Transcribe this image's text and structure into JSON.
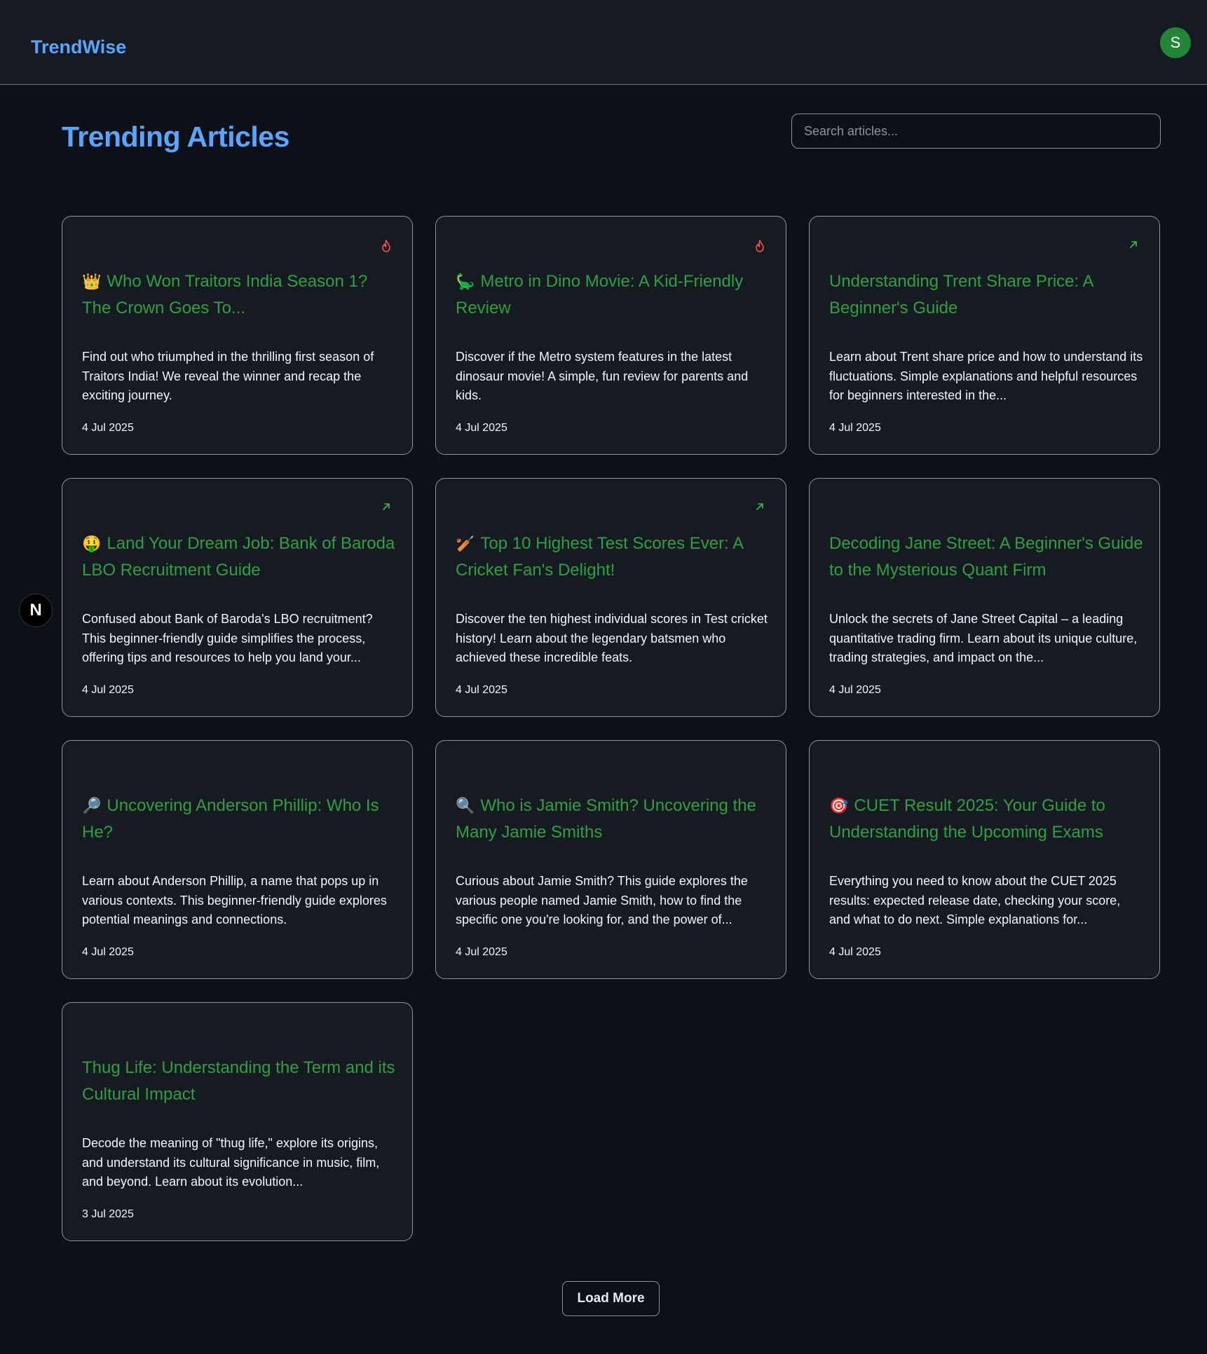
{
  "brand": "TrendWise",
  "user": {
    "initial": "S"
  },
  "page": {
    "title": "Trending Articles"
  },
  "search": {
    "placeholder": "Search articles..."
  },
  "floating_badge": "N",
  "articles": [
    {
      "emoji": "👑",
      "badge": "fire-icon",
      "title": "Who Won Traitors India Season 1? The Crown Goes To...",
      "description": "Find out who triumphed in the thrilling first season of Traitors India! We reveal the winner and recap the exciting journey.",
      "date": "4 Jul 2025"
    },
    {
      "emoji": "🦕",
      "badge": "fire-icon",
      "title": "Metro in Dino Movie: A Kid-Friendly Review",
      "description": "Discover if the Metro system features in the latest dinosaur movie! A simple, fun review for parents and kids.",
      "date": "4 Jul 2025"
    },
    {
      "emoji": "",
      "badge": "trend-arrow-icon",
      "title": "Understanding Trent Share Price: A Beginner's Guide",
      "description": "Learn about Trent share price and how to understand its fluctuations. Simple explanations and helpful resources for beginners interested in the...",
      "date": "4 Jul 2025"
    },
    {
      "emoji": "🤑",
      "badge": "trend-arrow-icon",
      "title": "Land Your Dream Job: Bank of Baroda LBO Recruitment Guide",
      "description": "Confused about Bank of Baroda's LBO recruitment? This beginner-friendly guide simplifies the process, offering tips and resources to help you land your...",
      "date": "4 Jul 2025"
    },
    {
      "emoji": "🏏",
      "badge": "trend-arrow-icon",
      "title": "Top 10 Highest Test Scores Ever: A Cricket Fan's Delight!",
      "description": "Discover the ten highest individual scores in Test cricket history! Learn about the legendary batsmen who achieved these incredible feats.",
      "date": "4 Jul 2025"
    },
    {
      "emoji": "",
      "badge": "",
      "title": "Decoding Jane Street: A Beginner's Guide to the Mysterious Quant Firm",
      "description": "Unlock the secrets of Jane Street Capital – a leading quantitative trading firm. Learn about its unique culture, trading strategies, and impact on the...",
      "date": "4 Jul 2025"
    },
    {
      "emoji": "🔎",
      "badge": "",
      "title": "Uncovering Anderson Phillip: Who Is He?",
      "description": "Learn about Anderson Phillip, a name that pops up in various contexts. This beginner-friendly guide explores potential meanings and connections.",
      "date": "4 Jul 2025"
    },
    {
      "emoji": "🔍",
      "badge": "",
      "title": "Who is Jamie Smith? Uncovering the Many Jamie Smiths",
      "description": "Curious about Jamie Smith? This guide explores the various people named Jamie Smith, how to find the specific one you're looking for, and the power of...",
      "date": "4 Jul 2025"
    },
    {
      "emoji": "🎯",
      "badge": "",
      "title": "CUET Result 2025: Your Guide to Understanding the Upcoming Exams",
      "description": "Everything you need to know about the CUET 2025 results: expected release date, checking your score, and what to do next. Simple explanations for...",
      "date": "4 Jul 2025"
    },
    {
      "emoji": "",
      "badge": "",
      "title": "Thug Life: Understanding the Term and its Cultural Impact",
      "description": "Decode the meaning of \"thug life,\" explore its origins, and understand its cultural significance in music, film, and beyond. Learn about its evolution...",
      "date": "3 Jul 2025"
    }
  ],
  "load_more_label": "Load More",
  "colors": {
    "background": "#0d1117",
    "surface": "#161b22",
    "accent_blue": "#58a6ff",
    "title_green": "#2ea043",
    "avatar_green": "#238636",
    "fire_red": "#f85149",
    "arrow_green": "#3fb950"
  }
}
